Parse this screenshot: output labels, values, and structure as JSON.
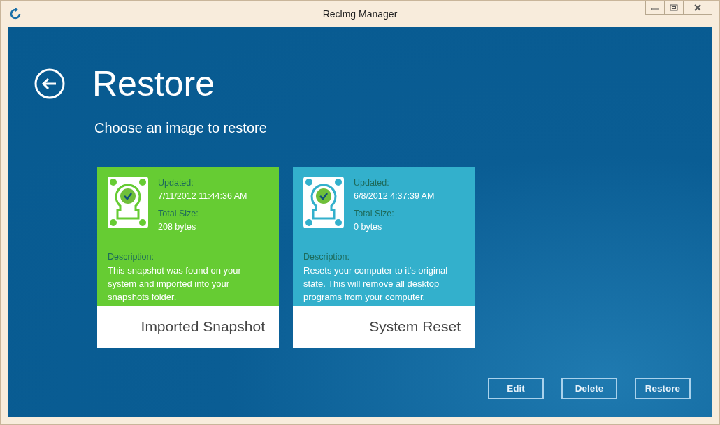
{
  "window": {
    "title": "Reclmg Manager"
  },
  "page": {
    "title": "Restore",
    "subtitle": "Choose an image to restore"
  },
  "images": [
    {
      "name": "Imported Snapshot",
      "color": "#66cc33",
      "updated_label": "Updated:",
      "updated": "7/11/2012 11:44:36 AM",
      "size_label": "Total Size:",
      "size": "208 bytes",
      "description_label": "Description:",
      "description": "This snapshot was found on your system and imported into your snapshots folder."
    },
    {
      "name": "System Reset",
      "color": "#33b0cc",
      "updated_label": "Updated:",
      "updated": "6/8/2012 4:37:39 AM",
      "size_label": "Total Size:",
      "size": "0 bytes",
      "description_label": "Description:",
      "description": "Resets your computer to it's original state. This will remove all desktop programs from your computer."
    }
  ],
  "buttons": [
    "Edit",
    "Delete",
    "Restore"
  ]
}
